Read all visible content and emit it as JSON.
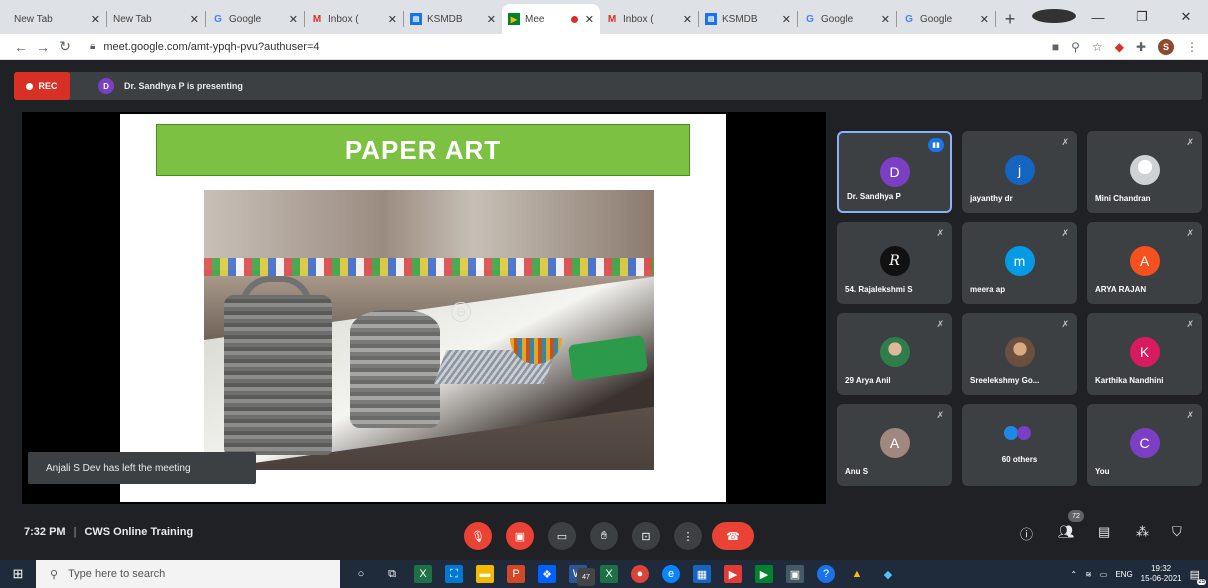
{
  "browser": {
    "tabs": [
      {
        "title": "New Tab",
        "icon": "none"
      },
      {
        "title": "New Tab",
        "icon": "none"
      },
      {
        "title": "Google",
        "icon": "G"
      },
      {
        "title": "Inbox (",
        "icon": "M"
      },
      {
        "title": "KSMDB",
        "icon": "K"
      },
      {
        "title": "Mee",
        "icon": "meet",
        "active": true
      },
      {
        "title": "Inbox (",
        "icon": "M"
      },
      {
        "title": "KSMDB",
        "icon": "K"
      },
      {
        "title": "Google",
        "icon": "G"
      },
      {
        "title": "Google",
        "icon": "G"
      }
    ],
    "url": "meet.google.com/amt-ypqh-pvu?authuser=4",
    "profile_initial": "S"
  },
  "meet": {
    "rec_label": "REC",
    "presenter_initial": "D",
    "presenting_text": "Dr. Sandhya P is presenting",
    "slide_title": "PAPER ART",
    "toast": "Anjali S Dev has left the meeting",
    "participants": [
      {
        "name": "Dr. Sandhya P",
        "initial": "D",
        "color": "#7b3fc4",
        "speaking": true
      },
      {
        "name": "jayanthy dr",
        "initial": "j",
        "color": "#1565c0"
      },
      {
        "name": "Mini Chandran",
        "initial": "",
        "color": "#e8eaed",
        "photo": true
      },
      {
        "name": "54. Rajalekshmi S",
        "initial": "R",
        "color": "#111111"
      },
      {
        "name": "meera ap",
        "initial": "m",
        "color": "#039be5"
      },
      {
        "name": "ARYA RAJAN",
        "initial": "A",
        "color": "#f4511e"
      },
      {
        "name": "29 Arya Anil",
        "initial": "",
        "color": "#2e7d4a",
        "photo": true
      },
      {
        "name": "Sreelekshmy Go...",
        "initial": "",
        "color": "#8a6d5a",
        "photo": true
      },
      {
        "name": "Karthika Nandhini",
        "initial": "K",
        "color": "#d81b60"
      },
      {
        "name": "Anu S",
        "initial": "A",
        "color": "#a1887f"
      },
      {
        "name": "",
        "initial": "",
        "others": "60 others"
      },
      {
        "name": "You",
        "initial": "C",
        "color": "#7b3fc4"
      }
    ],
    "time": "7:32 PM",
    "meeting_name": "CWS Online Training",
    "people_count": "72"
  },
  "taskbar": {
    "search_placeholder": "Type here to search",
    "lang": "ENG",
    "clock_time": "19:32",
    "clock_date": "15-06-2021",
    "notif_count": "25",
    "badge_count": "47"
  }
}
